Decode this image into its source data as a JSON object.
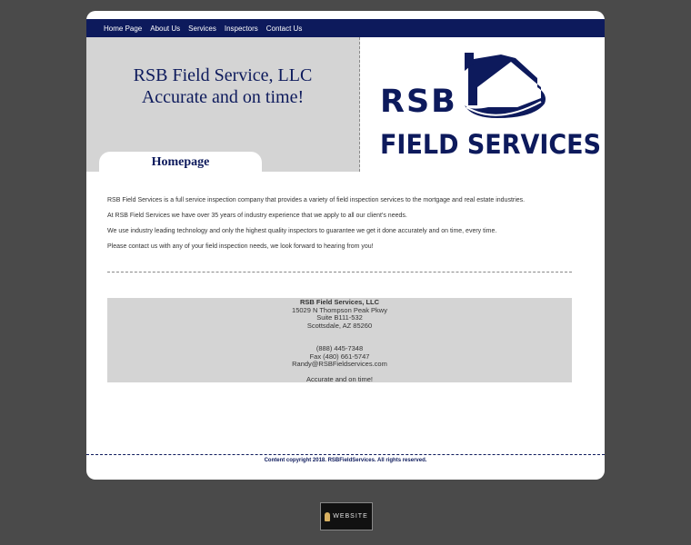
{
  "nav": {
    "items": [
      "Home Page",
      "About Us",
      "Services",
      "Inspectors",
      "Contact Us"
    ]
  },
  "hero": {
    "line1": "RSB Field Service, LLC",
    "line2": "Accurate and on time!"
  },
  "tab": {
    "label": "Homepage"
  },
  "logo": {
    "line1": "RSB",
    "line2": "FIELD SERVICES"
  },
  "content": {
    "p1": "RSB Field Services is a full service inspection company that provides a variety of field inspection services to the mortgage and real estate industries.",
    "p2": "At RSB Field Services we have over 35 years of industry experience that we apply to all our client’s needs.",
    "p3": "We use industry leading technology and only the highest quality inspectors to guarantee we get it done accurately and on time, every time.",
    "p4": "Please contact us with any of your field inspection needs, we look forward to hearing from you!"
  },
  "contact": {
    "name": "RSB Field Services, LLC",
    "address1": "15029 N Thompson Peak Pkwy",
    "address2": "Suite B111-532",
    "address3": "Scottsdale, AZ 85260",
    "phone": "(888) 445-7348",
    "fax": "Fax (480) 661-5747",
    "email": "Randy@RSBFieldservices.com",
    "tagline": "Accurate and on time!"
  },
  "footer": {
    "text": "Content copyright 2018. RSBFieldServices. All rights reserved."
  },
  "badge": {
    "label": "WEBSITE"
  },
  "colors": {
    "navy": "#0d1a5c",
    "panel_gray": "#d4d4d4",
    "background": "#4a4a4a"
  }
}
